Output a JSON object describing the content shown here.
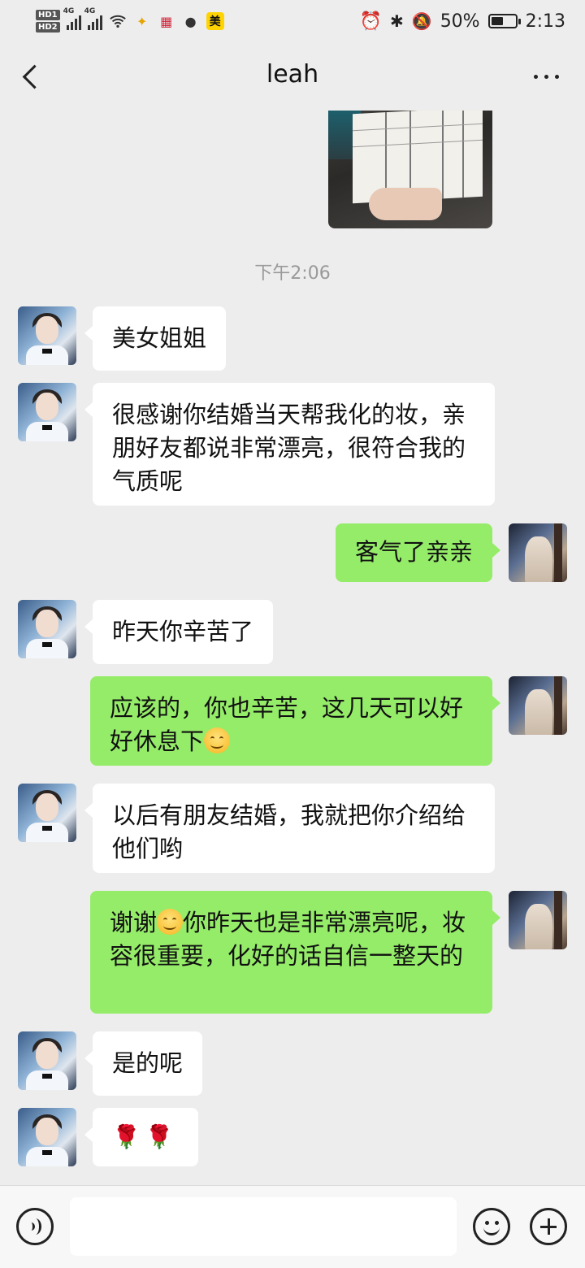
{
  "status_bar": {
    "network_1": "4G",
    "network_2": "4G",
    "app_badge": "美",
    "battery": "50%",
    "battery_level": 0.5,
    "time": "2:13",
    "icons": [
      "hd-icon",
      "signal-icon",
      "wifi-icon",
      "alarm-icon",
      "bluetooth-icon",
      "mute-icon",
      "battery-icon"
    ]
  },
  "header": {
    "title": "leah",
    "back_icon": "chevron-left-icon",
    "more_icon": "more-dots-icon"
  },
  "chat": {
    "timestamp": "下午2:06",
    "messages": [
      {
        "from": "leah",
        "text": "美女姐姐"
      },
      {
        "from": "leah",
        "text": "很感谢你结婚当天帮我化的妆，亲朋好友都说非常漂亮，很符合我的气质呢"
      },
      {
        "from": "me",
        "text": "客气了亲亲"
      },
      {
        "from": "leah",
        "text": "昨天你辛苦了"
      },
      {
        "from": "me",
        "text_before": "应该的，你也辛苦，这几天可以好好休息下",
        "emoji": "smile-emoji"
      },
      {
        "from": "leah",
        "text": "以后有朋友结婚，我就把你介绍给他们哟"
      },
      {
        "from": "me",
        "text_before": "谢谢",
        "emoji": "smile-emoji",
        "text_after": "你昨天也是非常漂亮呢，妆容很重要，化好的话自信一整天的"
      },
      {
        "from": "leah",
        "text": "是的呢"
      },
      {
        "from": "leah",
        "emoji": "rose-emoji",
        "glyph": "🌹"
      }
    ]
  },
  "input_bar": {
    "voice_icon": "voice-icon",
    "input_value": "",
    "emoji_icon": "emoji-face-icon",
    "add_icon": "plus-circle-icon"
  }
}
